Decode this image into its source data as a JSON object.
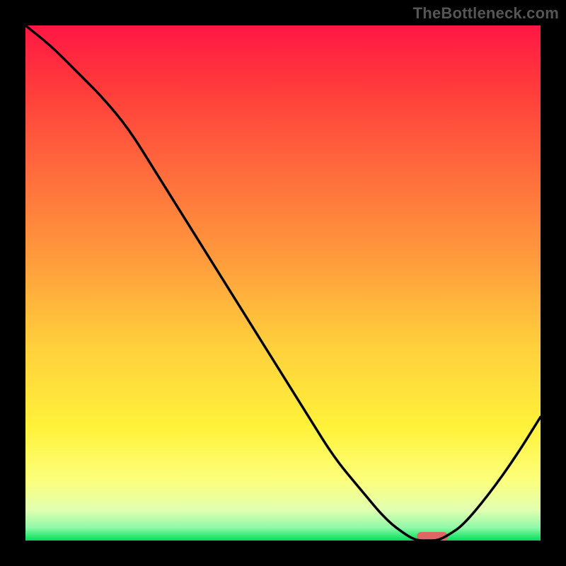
{
  "watermark": "TheBottleneck.com",
  "chart_data": {
    "type": "line",
    "title": "",
    "xlabel": "",
    "ylabel": "",
    "xlim": [
      0,
      100
    ],
    "ylim": [
      0,
      100
    ],
    "grid": false,
    "series": [
      {
        "name": "bottleneck-curve",
        "x": [
          0,
          5,
          10,
          15,
          20,
          25,
          30,
          35,
          40,
          45,
          50,
          55,
          60,
          65,
          70,
          74,
          76,
          78,
          80,
          82,
          85,
          90,
          95,
          100
        ],
        "y": [
          100,
          96,
          91,
          86,
          80,
          72,
          64,
          56,
          48,
          40,
          32,
          24,
          16,
          10,
          4,
          1,
          0,
          0,
          0,
          1,
          3,
          9,
          16,
          24
        ]
      }
    ],
    "marker": {
      "name": "optimal-range",
      "x_start": 76,
      "x_end": 82,
      "y": 0,
      "color": "#e06666"
    },
    "gradient_stops": [
      {
        "offset": 0.0,
        "color": "#ff1744"
      },
      {
        "offset": 0.12,
        "color": "#ff3b3b"
      },
      {
        "offset": 0.28,
        "color": "#ff6a3d"
      },
      {
        "offset": 0.45,
        "color": "#ff9a3c"
      },
      {
        "offset": 0.62,
        "color": "#ffcf3c"
      },
      {
        "offset": 0.78,
        "color": "#fff23a"
      },
      {
        "offset": 0.88,
        "color": "#fdff7a"
      },
      {
        "offset": 0.94,
        "color": "#e2ffb0"
      },
      {
        "offset": 0.975,
        "color": "#90f9a8"
      },
      {
        "offset": 1.0,
        "color": "#00e05a"
      }
    ]
  }
}
